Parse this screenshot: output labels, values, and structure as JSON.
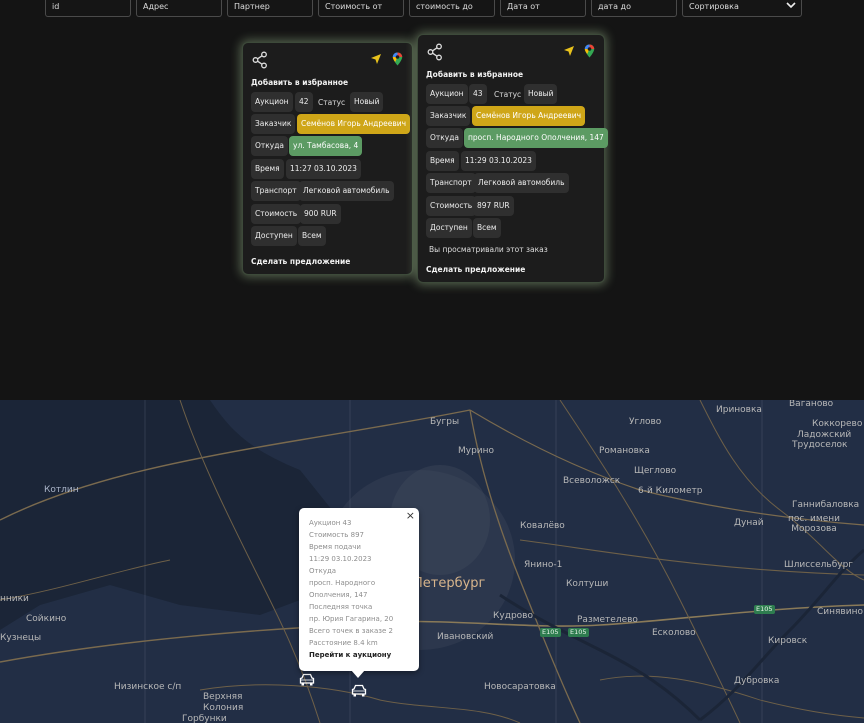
{
  "filters": {
    "id": "id",
    "address": "Адрес",
    "partner": "Партнер",
    "price_from": "Стоимость от",
    "price_to": "стоимость до",
    "date_from": "Дата от",
    "date_to": "дата до",
    "sort": "Сортировка"
  },
  "cards": [
    {
      "favorite": "Добавить в избранное",
      "auction_label": "Аукцион",
      "auction_value": "42",
      "status_label": "Статус",
      "status_value": "Новый",
      "customer_label": "Заказчик",
      "customer_value": "Семёнов Игорь Андреевич",
      "from_label": "Откуда",
      "from_value": "ул. Тамбасова, 4",
      "time_label": "Время",
      "time_value": "11:27 03.10.2023",
      "transport_label": "Транспорт",
      "transport_value": "Легковой автомобиль",
      "cost_label": "Стоимость",
      "cost_value": "900 RUR",
      "access_label": "Доступен",
      "access_value": "Всем",
      "offer": "Сделать предложение"
    },
    {
      "favorite": "Добавить в избранное",
      "auction_label": "Аукцион",
      "auction_value": "43",
      "status_label": "Статус",
      "status_value": "Новый",
      "customer_label": "Заказчик",
      "customer_value": "Семёнов Игорь Андреевич",
      "from_label": "Откуда",
      "from_value": "просп. Народного Ополчения, 147",
      "time_label": "Время",
      "time_value": "11:29 03.10.2023",
      "transport_label": "Транспорт",
      "transport_value": "Легковой автомобиль",
      "cost_label": "Стоимость",
      "cost_value": "897 RUR",
      "access_label": "Доступен",
      "access_value": "Всем",
      "viewed": "Вы просматривали этот заказ",
      "offer": "Сделать предложение"
    }
  ],
  "map": {
    "labels": {
      "bugry": "Бугры",
      "murino": "Мурино",
      "irinovka": "Ириновка",
      "vaganovo": "Ваганово",
      "kokkorevo": "Коккорево",
      "ladozhsky": "Ладожский",
      "trudoselok": "Трудоселок",
      "ugly": "Углово",
      "romanovka": "Романовка",
      "shcheglovo": "Щеглово",
      "km6": "6-й Километр",
      "vsevolozhsk": "Всеволожск",
      "kotlin": "Котлин",
      "gannibalovka": "Ганнибаловка",
      "dunay": "Дунай",
      "morozova": "пос. имени Морозова",
      "kovalevo": "Ковалёво",
      "yanino": "Янино-1",
      "shlisselburg": "Шлиссельбург",
      "peterburg": "Петербург",
      "koltushi": "Колтуши",
      "kudrovo": "Кудрово",
      "razmetelevo": "Разметелево",
      "sinyavino": "Синявино",
      "ivanovsky": "Ивановский",
      "ekolovo": "Есколово",
      "kirovsk": "Кировск",
      "soykino": "Сойкино",
      "nniki": "нники",
      "kuznecy": "Кузнецы",
      "nizinskoe": "Низинское с/п",
      "verkhnyaya": "Верхняя",
      "koloniya": "Колония",
      "gorbunki": "Горбунки",
      "novosaratovka": "Новосаратовка",
      "dubrovka": "Дубровка",
      "e105a": "E105",
      "e105b": "E105",
      "e105c": "E105"
    },
    "popup": {
      "auction": "Аукцион 43",
      "cost": "Стоимость 897",
      "time_label": "Время подачи",
      "time": "11:29 03.10.2023",
      "from_label": "Откуда",
      "from_1": "просп. Народного",
      "from_2": "Ополчения, 147",
      "last_label": "Последняя точка",
      "last": "пр. Юрия Гагарина, 20",
      "points": "Всего точек в заказе 2",
      "distance": "Расстояние 8.4 km",
      "go": "Перейти к аукциону",
      "close": "×"
    }
  },
  "colors": {
    "background": "#141414",
    "chip": "#2f2f2f",
    "customer_chip": "#cfa618",
    "from_chip": "#5c9b63",
    "card_glow": "#bee1aa",
    "map_bg": "#1f2b3e",
    "city_label": "#d8b58c"
  },
  "icons": [
    "share-icon",
    "navigation-arrow-icon",
    "map-pin-icon",
    "chevron-down-icon",
    "car-icon",
    "close-icon"
  ]
}
